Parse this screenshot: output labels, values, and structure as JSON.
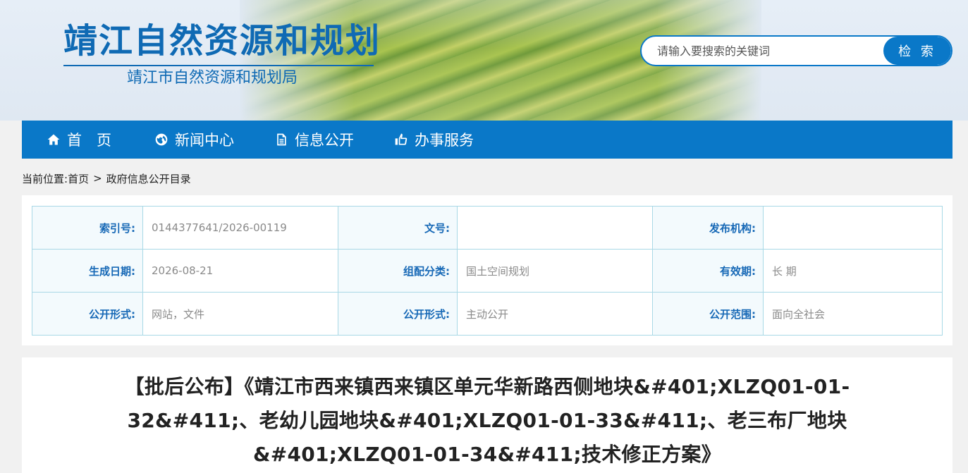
{
  "header": {
    "site_title": "靖江自然资源和规划",
    "site_subtitle": "靖江市自然资源和规划局",
    "search": {
      "placeholder": "请输入要搜索的关键词",
      "button_label": "检 索"
    }
  },
  "nav": {
    "items": [
      {
        "label": "首　页",
        "icon": "home-icon"
      },
      {
        "label": "新闻中心",
        "icon": "globe-icon"
      },
      {
        "label": "信息公开",
        "icon": "document-icon"
      },
      {
        "label": "办事服务",
        "icon": "thumbs-up-icon"
      }
    ]
  },
  "breadcrumb": {
    "prefix": "当前位置:",
    "home": "首页",
    "separator": ">",
    "current": "政府信息公开目录"
  },
  "meta": {
    "rows": [
      [
        {
          "label": "索引号:",
          "value": "0144377641/2026-00119"
        },
        {
          "label": "文号:",
          "value": ""
        },
        {
          "label": "发布机构:",
          "value": ""
        }
      ],
      [
        {
          "label": "生成日期:",
          "value": "2026-08-21"
        },
        {
          "label": "组配分类:",
          "value": "国土空间规划"
        },
        {
          "label": "有效期:",
          "value": "长 期"
        }
      ],
      [
        {
          "label": "公开形式:",
          "value": "网站，文件"
        },
        {
          "label": "公开形式:",
          "value": "主动公开"
        },
        {
          "label": "公开范围:",
          "value": "面向全社会"
        }
      ]
    ]
  },
  "article": {
    "title": "【批后公布】《靖江市西来镇西来镇区单元华新路西侧地块&#401;XLZQ01-01-32&#411;、老幼儿园地块&#401;XLZQ01-01-33&#411;、老三布厂地块&#401;XLZQ01-01-34&#411;技术修正方案》"
  },
  "colors": {
    "brand_blue": "#0a78c8",
    "title_blue": "#0f6ab4",
    "label_blue": "#1668b6",
    "table_border": "#a9d9e6"
  }
}
